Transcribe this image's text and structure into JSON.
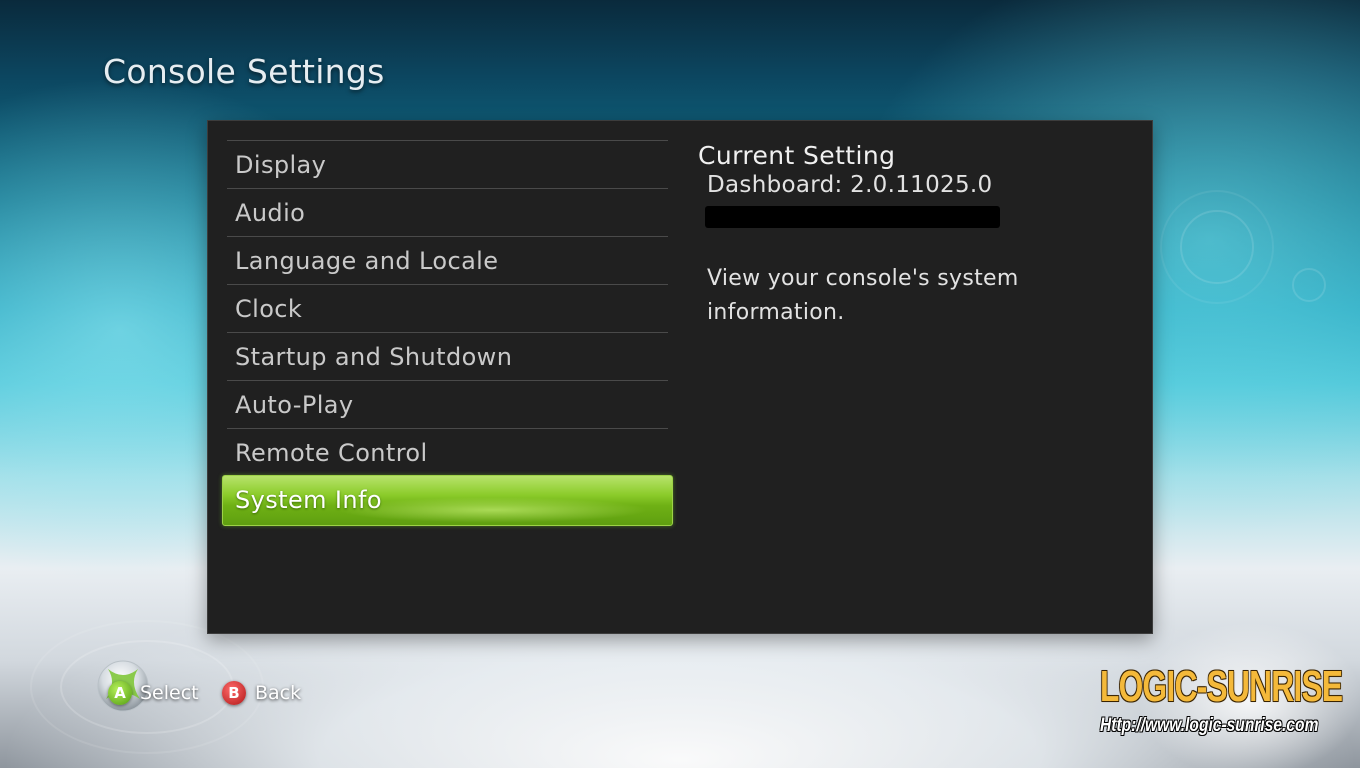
{
  "page": {
    "title": "Console Settings"
  },
  "menu": {
    "items": [
      {
        "label": "Display",
        "selected": false
      },
      {
        "label": "Audio",
        "selected": false
      },
      {
        "label": "Language and Locale",
        "selected": false
      },
      {
        "label": "Clock",
        "selected": false
      },
      {
        "label": "Startup and Shutdown",
        "selected": false
      },
      {
        "label": "Auto-Play",
        "selected": false
      },
      {
        "label": "Remote Control",
        "selected": false
      },
      {
        "label": "System Info",
        "selected": true
      }
    ]
  },
  "detail": {
    "heading": "Current Setting",
    "version": "Dashboard: 2.0.11025.0",
    "description": "View your console's system information."
  },
  "footer": {
    "select_key": "A",
    "select_label": "Select",
    "back_key": "B",
    "back_label": "Back"
  },
  "watermark": {
    "name": "LOGIC-SUNRISE",
    "url": "Http://www.logic-sunrise.com"
  },
  "colors": {
    "selection_green": "#6fb115",
    "panel_background": "#202020",
    "a_button": "#4f9a10",
    "b_button": "#b01818",
    "watermark_orange": "#f4b93a"
  },
  "icons": {
    "orb": "xbox-orb-icon",
    "a_button": "a-button-icon",
    "b_button": "b-button-icon"
  }
}
